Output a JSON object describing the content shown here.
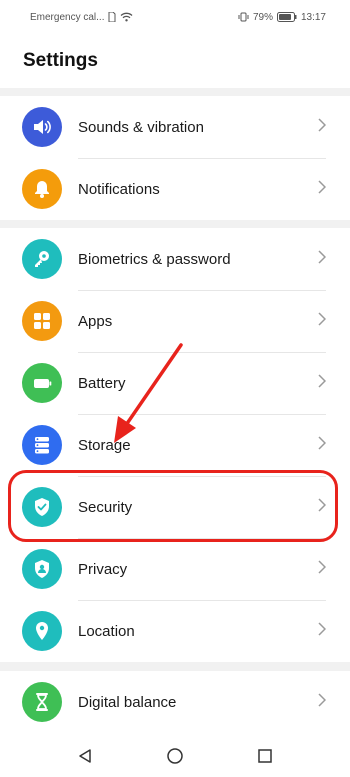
{
  "status_bar": {
    "carrier": "Emergency cal...",
    "battery": "79%",
    "time": "13:17"
  },
  "title": "Settings",
  "groups": [
    {
      "items": [
        {
          "label": "Sounds & vibration",
          "icon": "speaker-icon",
          "color": "#3d5bd9"
        },
        {
          "label": "Notifications",
          "icon": "bell-icon",
          "color": "#f49c0b"
        }
      ]
    },
    {
      "items": [
        {
          "label": "Biometrics & password",
          "icon": "key-icon",
          "color": "#1fbdbd"
        },
        {
          "label": "Apps",
          "icon": "apps-grid-icon",
          "color": "#f39a10"
        },
        {
          "label": "Battery",
          "icon": "battery-icon",
          "color": "#3fbf55"
        },
        {
          "label": "Storage",
          "icon": "storage-icon",
          "color": "#2f6cf0"
        },
        {
          "label": "Security",
          "icon": "shield-check-icon",
          "color": "#1fbdbd"
        },
        {
          "label": "Privacy",
          "icon": "privacy-shield-icon",
          "color": "#1fbdbd"
        },
        {
          "label": "Location",
          "icon": "location-pin-icon",
          "color": "#1fbdbd"
        }
      ]
    },
    {
      "items": [
        {
          "label": "Digital balance",
          "icon": "hourglass-icon",
          "color": "#3fbf55"
        }
      ]
    }
  ],
  "annotation": {
    "highlight_color": "#e8231c"
  }
}
